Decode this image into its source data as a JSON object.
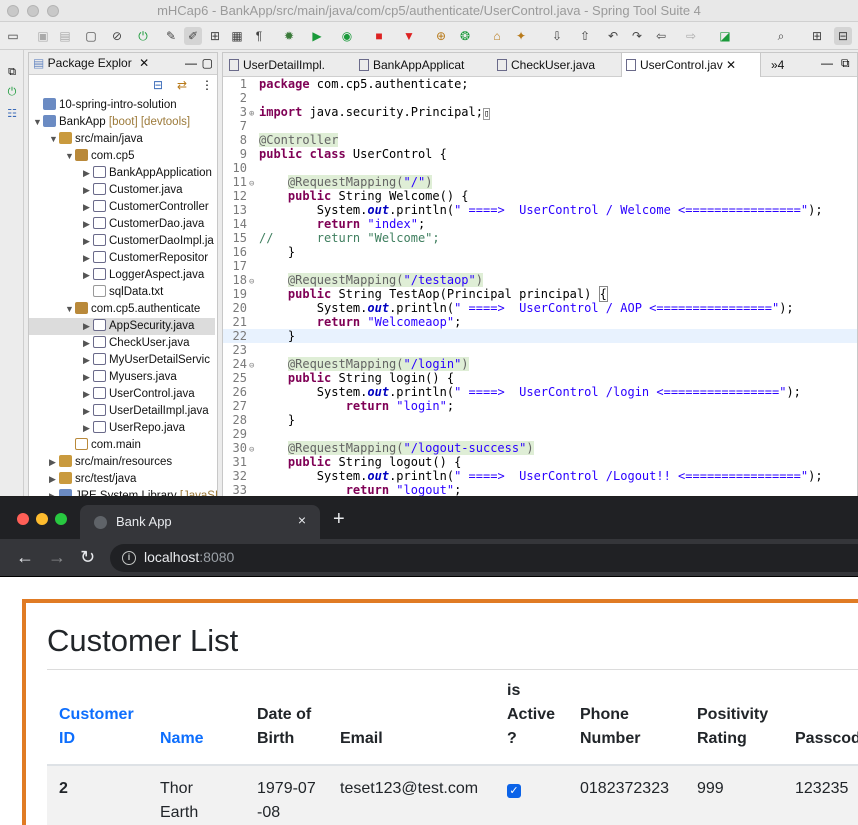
{
  "ide": {
    "window_title": "mHCap6 - BankApp/src/main/java/com/cp5/authenticate/UserControl.java - Spring Tool Suite 4",
    "package_explorer": {
      "tab_label": "Package Explor",
      "items": [
        {
          "label": "10-spring-intro-solution",
          "suffix": ""
        },
        {
          "label": "BankApp",
          "suffix": "[boot] [devtools]"
        },
        {
          "label": "src/main/java",
          "suffix": ""
        },
        {
          "label": "com.cp5",
          "suffix": ""
        },
        {
          "label": "BankAppApplication",
          "suffix": ""
        },
        {
          "label": "Customer.java",
          "suffix": ""
        },
        {
          "label": "CustomerController",
          "suffix": ""
        },
        {
          "label": "CustomerDao.java",
          "suffix": ""
        },
        {
          "label": "CustomerDaoImpl.ja",
          "suffix": ""
        },
        {
          "label": "CustomerRepositor",
          "suffix": ""
        },
        {
          "label": "LoggerAspect.java",
          "suffix": ""
        },
        {
          "label": "sqlData.txt",
          "suffix": ""
        },
        {
          "label": "com.cp5.authenticate",
          "suffix": ""
        },
        {
          "label": "AppSecurity.java",
          "suffix": ""
        },
        {
          "label": "CheckUser.java",
          "suffix": ""
        },
        {
          "label": "MyUserDetailServic",
          "suffix": ""
        },
        {
          "label": "Myusers.java",
          "suffix": ""
        },
        {
          "label": "UserControl.java",
          "suffix": ""
        },
        {
          "label": "UserDetailImpl.java",
          "suffix": ""
        },
        {
          "label": "UserRepo.java",
          "suffix": ""
        },
        {
          "label": "com.main",
          "suffix": ""
        },
        {
          "label": "src/main/resources",
          "suffix": ""
        },
        {
          "label": "src/test/java",
          "suffix": ""
        },
        {
          "label": "JRE System Library",
          "suffix": "[JavaSE"
        }
      ]
    },
    "editor_tabs": [
      {
        "label": "UserDetailImpl."
      },
      {
        "label": "BankAppApplicat"
      },
      {
        "label": "CheckUser.java"
      },
      {
        "label": "UserControl.jav",
        "close": "✕"
      },
      {
        "label": "»4"
      }
    ],
    "code_lines": [
      "1",
      "2",
      "3",
      "7",
      "8",
      "9",
      "10",
      "11",
      "12",
      "13",
      "14",
      "15",
      "16",
      "17",
      "18",
      "19",
      "20",
      "21",
      "22",
      "23",
      "24",
      "25",
      "26",
      "27",
      "28",
      "29",
      "30",
      "31",
      "32",
      "33"
    ]
  },
  "browser": {
    "tab_title": "Bank App",
    "tab_close": "×",
    "new_tab": "+",
    "url_host": "localhost",
    "url_port": ":8080",
    "page": {
      "heading": "Customer List",
      "headers": [
        "Customer ID",
        "Name",
        "Date of Birth",
        "Email",
        "is Active ?",
        "Phone Number",
        "Positivity Rating",
        "Passcode"
      ],
      "row": {
        "id": "2",
        "name": "Thor Earth",
        "dob": "1979-07-08",
        "email": "teset123@test.com",
        "active": true,
        "phone": "0182372323",
        "rating": "999",
        "passcode": "123235"
      }
    }
  },
  "colors": {
    "frame": "#e07b24",
    "link": "#0d6efd",
    "checkbox": "#0b63e8"
  }
}
